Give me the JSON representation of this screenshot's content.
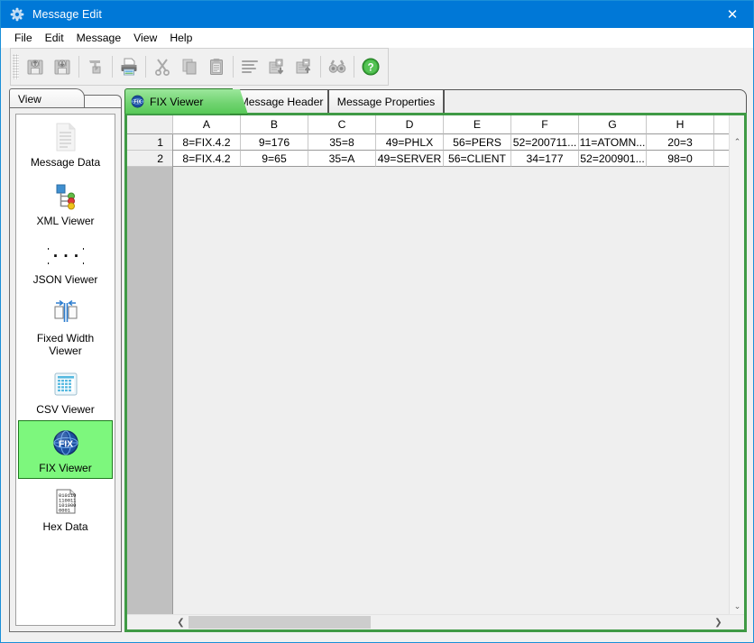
{
  "window": {
    "title": "Message Edit",
    "icon": "app-gear-icon",
    "close_label": "✕",
    "accent": "#0078d7"
  },
  "menubar": {
    "items": [
      {
        "label": "File"
      },
      {
        "label": "Edit"
      },
      {
        "label": "Message"
      },
      {
        "label": "View"
      },
      {
        "label": "Help"
      }
    ]
  },
  "toolbar": {
    "buttons": [
      {
        "name": "open-icon",
        "tip": "Open"
      },
      {
        "name": "save-icon",
        "tip": "Save"
      },
      {
        "sep": true
      },
      {
        "name": "font-icon",
        "tip": "Font"
      },
      {
        "sep": true
      },
      {
        "name": "print-icon",
        "tip": "Print"
      },
      {
        "sep": true
      },
      {
        "name": "cut-icon",
        "tip": "Cut"
      },
      {
        "name": "copy-icon",
        "tip": "Copy"
      },
      {
        "name": "paste-icon",
        "tip": "Paste"
      },
      {
        "sep": true
      },
      {
        "name": "format-icon",
        "tip": "Format"
      },
      {
        "name": "insert-message-icon",
        "tip": "Insert Message"
      },
      {
        "name": "delete-message-icon",
        "tip": "Delete Message"
      },
      {
        "sep": true
      },
      {
        "name": "find-icon",
        "tip": "Find"
      },
      {
        "sep": true
      },
      {
        "name": "help-icon",
        "tip": "Help"
      }
    ]
  },
  "view_panel": {
    "tab_label": "View",
    "items": [
      {
        "label": "Message Data",
        "icon": "document-lines-icon",
        "selected": false
      },
      {
        "label": "XML Viewer",
        "icon": "xml-tree-icon",
        "selected": false
      },
      {
        "label": "JSON Viewer",
        "icon": "json-braces-icon",
        "selected": false
      },
      {
        "label": "Fixed Width Viewer",
        "icon": "fixed-width-icon",
        "selected": false
      },
      {
        "label": "CSV Viewer",
        "icon": "csv-grid-icon",
        "selected": false
      },
      {
        "label": "FIX Viewer",
        "icon": "fix-globe-icon",
        "selected": true
      },
      {
        "label": "Hex Data",
        "icon": "hex-binary-icon",
        "selected": false
      }
    ],
    "selected_bg": "#7df77d",
    "selected_border": "#1f7a1f"
  },
  "document_tabs": {
    "tabs": [
      {
        "label": "FIX Viewer",
        "icon": "fix-globe-icon",
        "active": true
      },
      {
        "label": "Message Header",
        "active": false
      },
      {
        "label": "Message Properties",
        "active": false
      }
    ],
    "active_color": "#57c957"
  },
  "sheet": {
    "columns": [
      "A",
      "B",
      "C",
      "D",
      "E",
      "F",
      "G",
      "H"
    ],
    "rows": [
      {
        "number": "1",
        "cells": [
          "8=FIX.4.2",
          "9=176",
          "35=8",
          "49=PHLX",
          "56=PERS",
          "52=200711...",
          "11=ATOMN...",
          "20=3"
        ]
      },
      {
        "number": "2",
        "cells": [
          "8=FIX.4.2",
          "9=65",
          "35=A",
          "49=SERVER",
          "56=CLIENT",
          "34=177",
          "52=200901...",
          "98=0"
        ]
      }
    ],
    "scroll_up_glyph": "⌃",
    "scroll_down_glyph": "⌄",
    "scroll_left_glyph": "❮",
    "scroll_right_glyph": "❯"
  }
}
